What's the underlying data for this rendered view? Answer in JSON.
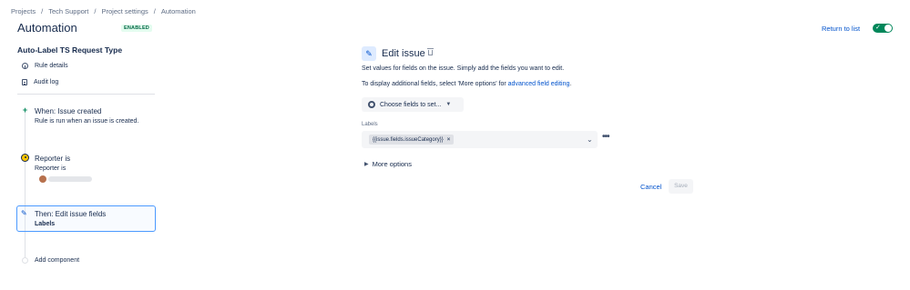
{
  "breadcrumb": [
    "Projects",
    "Tech Support",
    "Project settings",
    "Automation"
  ],
  "header": {
    "title": "Automation",
    "badge": "ENABLED",
    "return_link": "Return to list"
  },
  "sidebar": {
    "rule_name": "Auto-Label TS Request Type",
    "links": [
      {
        "label": "Rule details",
        "icon": "info-icon"
      },
      {
        "label": "Audit log",
        "icon": "log-icon"
      }
    ]
  },
  "flow": {
    "trigger": {
      "title": "When: Issue created",
      "subtitle": "Rule is run when an issue is created."
    },
    "condition": {
      "title": "Reporter is",
      "subtitle": "Reporter is"
    },
    "action": {
      "title": "Then: Edit issue fields",
      "subtitle": "Labels"
    },
    "add_label": "Add component"
  },
  "panel": {
    "title": "Edit issue",
    "desc1": "Set values for fields on the issue. Simply add the fields you want to edit.",
    "desc2_prefix": "To display additional fields, select 'More options' for ",
    "desc2_link": "advanced field editing",
    "desc2_suffix": ".",
    "choose_button": "Choose fields to set...",
    "field_label": "Labels",
    "field_value": "{{issue.fields.issueCategory}}",
    "more_options": "More options",
    "cancel": "Cancel",
    "save": "Save"
  },
  "colors": {
    "accent": "#0052cc",
    "enabled": "#00875a",
    "selected_border": "#4c9aff"
  }
}
